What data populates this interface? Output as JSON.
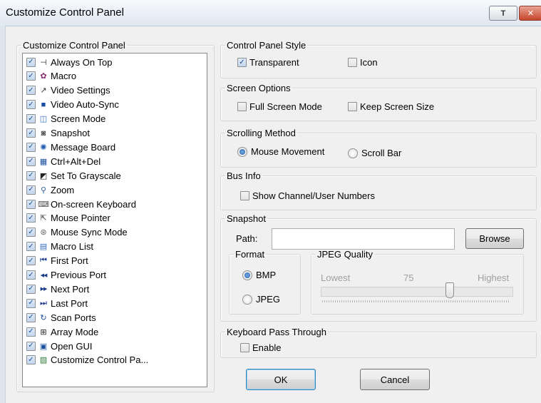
{
  "window": {
    "title": "Customize Control Panel",
    "pin_label": "T",
    "close_label": "✕"
  },
  "list_group": {
    "legend": "Customize Control Panel",
    "items": [
      {
        "label": "Always On Top",
        "checked": true,
        "icon": "pin-icon",
        "glyph": "⊣"
      },
      {
        "label": "Macro",
        "checked": true,
        "icon": "macro-icon",
        "glyph": "✿"
      },
      {
        "label": "Video Settings",
        "checked": true,
        "icon": "wrench-icon",
        "glyph": "↗"
      },
      {
        "label": "Video Auto-Sync",
        "checked": true,
        "icon": "video-sync-icon",
        "glyph": "■"
      },
      {
        "label": "Screen Mode",
        "checked": true,
        "icon": "screen-mode-icon",
        "glyph": "◫"
      },
      {
        "label": "Snapshot",
        "checked": true,
        "icon": "camera-icon",
        "glyph": "◙"
      },
      {
        "label": "Message Board",
        "checked": true,
        "icon": "message-board-icon",
        "glyph": "✺"
      },
      {
        "label": "Ctrl+Alt+Del",
        "checked": true,
        "icon": "ctrl-alt-del-icon",
        "glyph": "▦"
      },
      {
        "label": "Set To Grayscale",
        "checked": true,
        "icon": "grayscale-icon",
        "glyph": "◩"
      },
      {
        "label": "Zoom",
        "checked": true,
        "icon": "zoom-icon",
        "glyph": "⚲"
      },
      {
        "label": "On-screen Keyboard",
        "checked": true,
        "icon": "keyboard-icon",
        "glyph": "⌨"
      },
      {
        "label": "Mouse Pointer",
        "checked": true,
        "icon": "mouse-pointer-icon",
        "glyph": "⇱"
      },
      {
        "label": "Mouse Sync Mode",
        "checked": true,
        "icon": "mouse-icon",
        "glyph": "⊛"
      },
      {
        "label": "Macro List",
        "checked": true,
        "icon": "macro-list-icon",
        "glyph": "▤"
      },
      {
        "label": "First Port",
        "checked": true,
        "icon": "first-port-icon",
        "glyph": "⏮"
      },
      {
        "label": "Previous Port",
        "checked": true,
        "icon": "previous-port-icon",
        "glyph": "◀◀"
      },
      {
        "label": "Next Port",
        "checked": true,
        "icon": "next-port-icon",
        "glyph": "▶▶"
      },
      {
        "label": "Last Port",
        "checked": true,
        "icon": "last-port-icon",
        "glyph": "⏭"
      },
      {
        "label": "Scan Ports",
        "checked": true,
        "icon": "scan-ports-icon",
        "glyph": "↻"
      },
      {
        "label": "Array Mode",
        "checked": true,
        "icon": "array-mode-icon",
        "glyph": "⊞"
      },
      {
        "label": "Open GUI",
        "checked": true,
        "icon": "open-gui-icon",
        "glyph": "▣"
      },
      {
        "label": "Customize Control Pa...",
        "checked": true,
        "icon": "customize-icon",
        "glyph": "▨"
      }
    ]
  },
  "style_group": {
    "legend": "Control Panel Style",
    "transparent_label": "Transparent",
    "transparent_checked": true,
    "icon_label": "Icon",
    "icon_checked": false
  },
  "screen_group": {
    "legend": "Screen Options",
    "full_screen_label": "Full Screen Mode",
    "keep_size_label": "Keep Screen Size"
  },
  "scroll_group": {
    "legend": "Scrolling Method",
    "mouse_movement_label": "Mouse Movement",
    "scroll_bar_label": "Scroll Bar",
    "selected": "Mouse Movement"
  },
  "bus_group": {
    "legend": "Bus Info",
    "show_numbers_label": "Show Channel/User Numbers"
  },
  "snapshot_group": {
    "legend": "Snapshot",
    "path_label": "Path:",
    "path_value": "",
    "browse_label": "Browse",
    "format_legend": "Format",
    "bmp_label": "BMP",
    "jpeg_label": "JPEG",
    "format_selected": "BMP",
    "quality_legend": "JPEG Quality",
    "lowest_label": "Lowest",
    "quality_value": "75",
    "highest_label": "Highest",
    "quality_fraction": 0.68
  },
  "keyboard_group": {
    "legend": "Keyboard Pass Through",
    "enable_label": "Enable"
  },
  "buttons": {
    "ok_label": "OK",
    "cancel_label": "Cancel"
  },
  "colors": {
    "check_color": "#1d4f91",
    "radio_dot": "#1c5aa8"
  }
}
